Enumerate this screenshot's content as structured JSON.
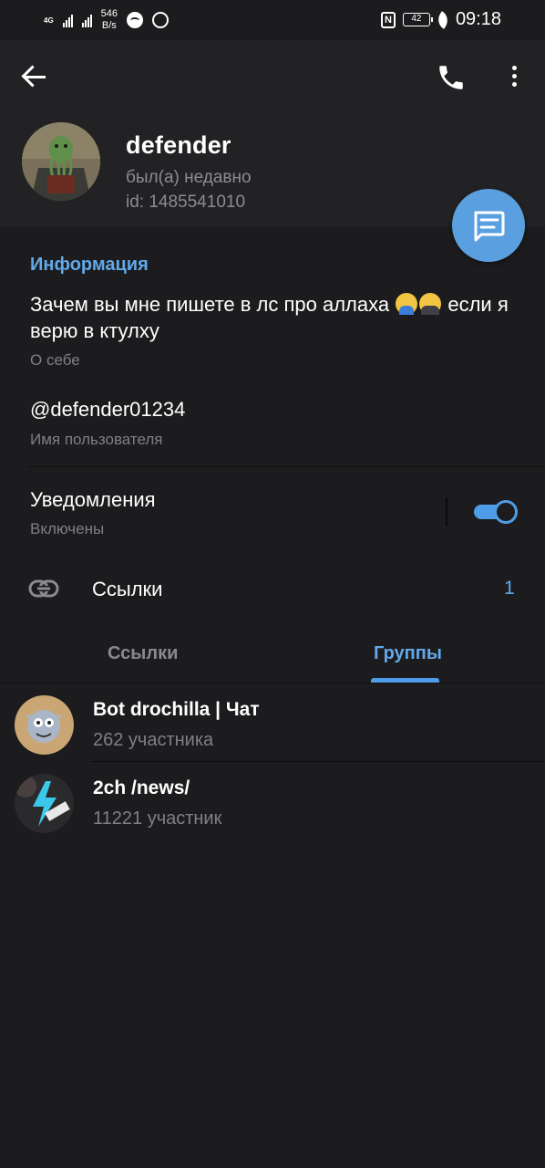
{
  "status_bar": {
    "network": [
      "4G",
      "4G"
    ],
    "speed": "546",
    "speed_unit": "B/s",
    "nfc": "N",
    "battery": "42",
    "time": "09:18"
  },
  "header": {
    "back_icon": "arrow-left-icon",
    "call_icon": "phone-icon",
    "more_icon": "more-vertical-icon",
    "name": "defender",
    "last_seen": "был(а) недавно",
    "user_id": "id: 1485541010",
    "fab_icon": "message-icon"
  },
  "info": {
    "title": "Информация",
    "bio_before": "Зачем вы мне пишете в лс про аллаха",
    "bio_after": " если я верю в ктулху",
    "bio_emojis": [
      "shrug-emoji",
      "facepalm-emoji"
    ],
    "bio_caption": "О себе",
    "username": "@defender01234",
    "username_caption": "Имя пользователя",
    "notifications_title": "Уведомления",
    "notifications_caption": "Включены",
    "notifications_on": true,
    "links_icon": "link-icon",
    "links_label": "Ссылки",
    "links_count": "1"
  },
  "tabs": {
    "items": [
      "Ссылки",
      "Группы"
    ],
    "active": "Группы"
  },
  "groups": [
    {
      "name": "Bot drochilla | Чат",
      "members": "262 участника"
    },
    {
      "name": "2ch /news/",
      "members": "11221 участник"
    }
  ],
  "colors": {
    "accent": "#62a9ea",
    "background": "#1c1c1e",
    "header": "#222224",
    "secondary_text": "#8c8c8e"
  }
}
